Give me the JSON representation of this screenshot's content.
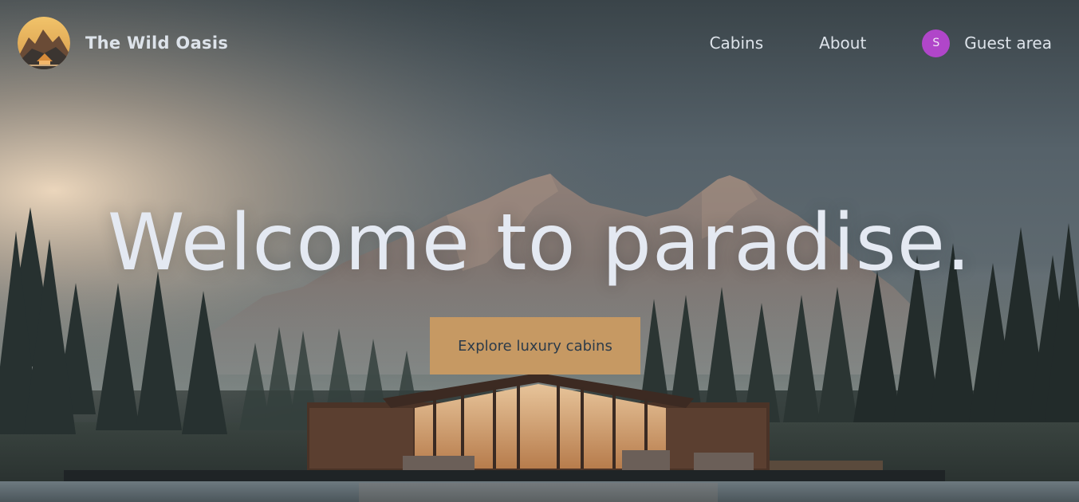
{
  "header": {
    "brand": "The Wild Oasis",
    "nav": [
      {
        "label": "Cabins"
      },
      {
        "label": "About"
      },
      {
        "label": "Guest area",
        "avatar_initial": "S"
      }
    ]
  },
  "hero": {
    "headline": "Welcome to paradise.",
    "cta_label": "Explore luxury cabins"
  },
  "colors": {
    "accent": "#c69963",
    "avatar": "#b046c9",
    "text_light": "#dde3ea",
    "cta_text": "#2c3b4a"
  }
}
